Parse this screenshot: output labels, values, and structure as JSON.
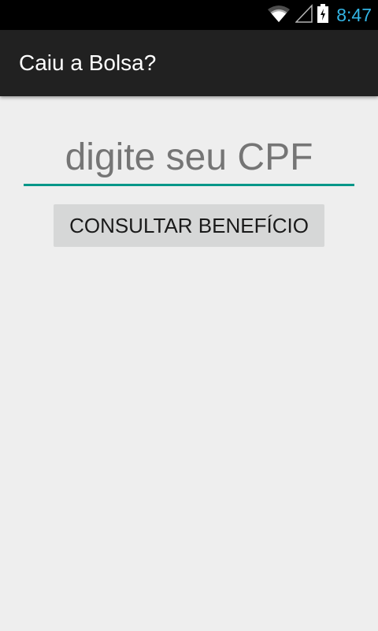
{
  "status_bar": {
    "time": "8:47",
    "icons": [
      "wifi-icon",
      "signal-icon",
      "battery-charging-icon"
    ],
    "time_color": "#33b5e5"
  },
  "app_bar": {
    "title": "Caiu a Bolsa?",
    "background": "#212121"
  },
  "form": {
    "cpf_placeholder": "digite seu CPF",
    "cpf_value": "",
    "underline_color": "#009688",
    "consult_label": "CONSULTAR BENEFÍCIO"
  }
}
